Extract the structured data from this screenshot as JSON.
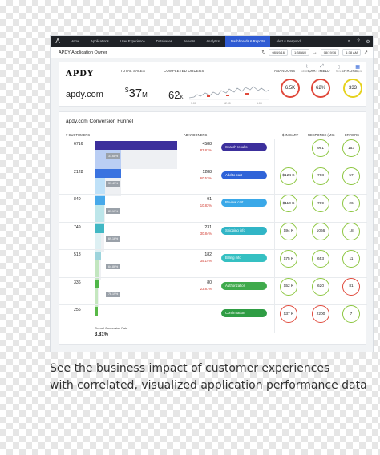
{
  "nav": {
    "logo": "Λ",
    "items": [
      "Home",
      "Applications",
      "User Experience",
      "Databases",
      "Servers",
      "Analytics",
      "Dashboards & Reports",
      "Alert & Respond"
    ],
    "active_index": 6
  },
  "subbar": {
    "title": "APDY Application Owner",
    "date_from": "08/19/16",
    "time_from": "1:38 AM",
    "date_to": "08/19/16",
    "time_to": "1:38 AM"
  },
  "toolbar": {
    "tools": [
      {
        "icon": "line-chart-icon",
        "label": "Edit Widgets"
      },
      {
        "icon": "expand-icon",
        "label": "Actions"
      },
      {
        "icon": "page-icon",
        "label": "More"
      },
      {
        "icon": "grid-icon",
        "label": "Widgets"
      }
    ]
  },
  "summary": {
    "brand": "APDY",
    "host": "apdy.com",
    "total_sales_label": "TOTAL SALES",
    "currency": "$",
    "total_sales_value": "37",
    "total_sales_unit": "M",
    "completed_orders_label": "COMPLETED ORDERS",
    "completed_orders_value": "62",
    "completed_orders_unit": "K",
    "abandons_label": "ABANDONS",
    "abandons_value": "6.5K",
    "cart_yield_label": "CART YIELD",
    "cart_yield_value": "62%",
    "errors_label": "ERRORS",
    "errors_value": "333",
    "spark_ticks": [
      "7:00",
      "12:00",
      "6:00"
    ]
  },
  "funnel": {
    "title": "apdy.com Conversion Funnel",
    "headers": {
      "customers": "# CUSTOMERS",
      "abandoners": "ABANDONERS",
      "in_cart": "$ IN CART",
      "response": "RESPONSE (MS)",
      "errors": "ERRORS"
    },
    "rows": [
      {
        "customers": "6716",
        "fraction": 1.0,
        "bar_color": "#3c2f9c",
        "conversion": "31.68%",
        "abandoners": "4588",
        "abandon_pct": "83.81%",
        "stage": "Search results",
        "stage_color": "#3c2f9c",
        "in_cart": "",
        "response": "961",
        "errors": "153"
      },
      {
        "customers": "2128",
        "fraction": 0.317,
        "bar_color": "#3a73e0",
        "conversion": "39.47%",
        "abandoners": "1288",
        "abandon_pct": "60.53%",
        "stage": "Add to cart",
        "stage_color": "#2f63d8",
        "in_cart": "$124 K",
        "response": "768",
        "errors": "57"
      },
      {
        "customers": "840",
        "fraction": 0.125,
        "bar_color": "#47a9ea",
        "conversion": "89.17%",
        "abandoners": "91",
        "abandon_pct": "10.83%",
        "stage": "Review cart",
        "stage_color": "#3aa8e8",
        "in_cart": "$110 K",
        "response": "789",
        "errors": "26"
      },
      {
        "customers": "749",
        "fraction": 0.112,
        "bar_color": "#41b8c4",
        "conversion": "69.16%",
        "abandoners": "231",
        "abandon_pct": "30.84%",
        "stage": "Shipping info",
        "stage_color": "#31b5c6",
        "in_cart": "$94 K",
        "response": "1066",
        "errors": "18"
      },
      {
        "customers": "518",
        "fraction": 0.077,
        "bar_color": "#9dd4dc",
        "conversion": "64.86%",
        "abandoners": "182",
        "abandon_pct": "35.14%",
        "stage": "Billing info",
        "stage_color": "#35c0c2",
        "in_cart": "$75 K",
        "response": "653",
        "errors": "11"
      },
      {
        "customers": "336",
        "fraction": 0.05,
        "bar_color": "#4fb748",
        "conversion": "76.19%",
        "abandoners": "80",
        "abandon_pct": "23.81%",
        "stage": "Authorization",
        "stage_color": "#3faa4c",
        "in_cart": "$52 K",
        "response": "620",
        "errors": "81"
      },
      {
        "customers": "256",
        "fraction": 0.038,
        "bar_color": "#58b947",
        "conversion": "",
        "abandoners": "",
        "abandon_pct": "",
        "stage": "Confirmation",
        "stage_color": "#2f9d44",
        "in_cart": "$37 K",
        "response": "2200",
        "errors": "7"
      }
    ],
    "status": [
      {
        "in_cart": "",
        "response": "green",
        "errors": "green"
      },
      {
        "in_cart": "green",
        "response": "green",
        "errors": "green"
      },
      {
        "in_cart": "green",
        "response": "green",
        "errors": "green"
      },
      {
        "in_cart": "green",
        "response": "green",
        "errors": "green"
      },
      {
        "in_cart": "green",
        "response": "green",
        "errors": "green"
      },
      {
        "in_cart": "green",
        "response": "green",
        "errors": "red"
      },
      {
        "in_cart": "red",
        "response": "red",
        "errors": "green"
      }
    ],
    "overall_label": "Overall Conversion Rate",
    "overall_value": "3.81%"
  },
  "colors": {
    "green": "#8cc63f",
    "red": "#e0493b",
    "orange": "#f5a623",
    "yellow": "#e6d21e"
  },
  "caption": {
    "line1": "See the business impact of customer experiences",
    "line2": "with correlated, visualized application performance data"
  }
}
